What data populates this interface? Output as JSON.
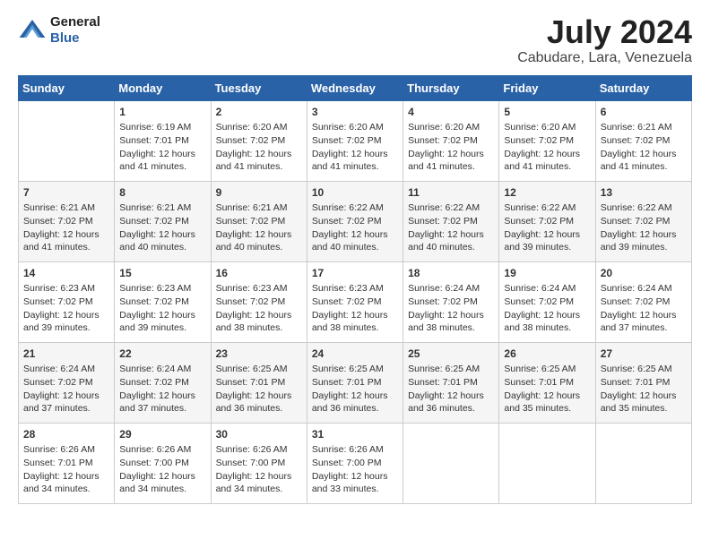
{
  "header": {
    "logo_general": "General",
    "logo_blue": "Blue",
    "month_title": "July 2024",
    "location": "Cabudare, Lara, Venezuela"
  },
  "weekdays": [
    "Sunday",
    "Monday",
    "Tuesday",
    "Wednesday",
    "Thursday",
    "Friday",
    "Saturday"
  ],
  "weeks": [
    [
      {
        "day": "",
        "info": ""
      },
      {
        "day": "1",
        "info": "Sunrise: 6:19 AM\nSunset: 7:01 PM\nDaylight: 12 hours\nand 41 minutes."
      },
      {
        "day": "2",
        "info": "Sunrise: 6:20 AM\nSunset: 7:02 PM\nDaylight: 12 hours\nand 41 minutes."
      },
      {
        "day": "3",
        "info": "Sunrise: 6:20 AM\nSunset: 7:02 PM\nDaylight: 12 hours\nand 41 minutes."
      },
      {
        "day": "4",
        "info": "Sunrise: 6:20 AM\nSunset: 7:02 PM\nDaylight: 12 hours\nand 41 minutes."
      },
      {
        "day": "5",
        "info": "Sunrise: 6:20 AM\nSunset: 7:02 PM\nDaylight: 12 hours\nand 41 minutes."
      },
      {
        "day": "6",
        "info": "Sunrise: 6:21 AM\nSunset: 7:02 PM\nDaylight: 12 hours\nand 41 minutes."
      }
    ],
    [
      {
        "day": "7",
        "info": "Sunrise: 6:21 AM\nSunset: 7:02 PM\nDaylight: 12 hours\nand 41 minutes."
      },
      {
        "day": "8",
        "info": "Sunrise: 6:21 AM\nSunset: 7:02 PM\nDaylight: 12 hours\nand 40 minutes."
      },
      {
        "day": "9",
        "info": "Sunrise: 6:21 AM\nSunset: 7:02 PM\nDaylight: 12 hours\nand 40 minutes."
      },
      {
        "day": "10",
        "info": "Sunrise: 6:22 AM\nSunset: 7:02 PM\nDaylight: 12 hours\nand 40 minutes."
      },
      {
        "day": "11",
        "info": "Sunrise: 6:22 AM\nSunset: 7:02 PM\nDaylight: 12 hours\nand 40 minutes."
      },
      {
        "day": "12",
        "info": "Sunrise: 6:22 AM\nSunset: 7:02 PM\nDaylight: 12 hours\nand 39 minutes."
      },
      {
        "day": "13",
        "info": "Sunrise: 6:22 AM\nSunset: 7:02 PM\nDaylight: 12 hours\nand 39 minutes."
      }
    ],
    [
      {
        "day": "14",
        "info": "Sunrise: 6:23 AM\nSunset: 7:02 PM\nDaylight: 12 hours\nand 39 minutes."
      },
      {
        "day": "15",
        "info": "Sunrise: 6:23 AM\nSunset: 7:02 PM\nDaylight: 12 hours\nand 39 minutes."
      },
      {
        "day": "16",
        "info": "Sunrise: 6:23 AM\nSunset: 7:02 PM\nDaylight: 12 hours\nand 38 minutes."
      },
      {
        "day": "17",
        "info": "Sunrise: 6:23 AM\nSunset: 7:02 PM\nDaylight: 12 hours\nand 38 minutes."
      },
      {
        "day": "18",
        "info": "Sunrise: 6:24 AM\nSunset: 7:02 PM\nDaylight: 12 hours\nand 38 minutes."
      },
      {
        "day": "19",
        "info": "Sunrise: 6:24 AM\nSunset: 7:02 PM\nDaylight: 12 hours\nand 38 minutes."
      },
      {
        "day": "20",
        "info": "Sunrise: 6:24 AM\nSunset: 7:02 PM\nDaylight: 12 hours\nand 37 minutes."
      }
    ],
    [
      {
        "day": "21",
        "info": "Sunrise: 6:24 AM\nSunset: 7:02 PM\nDaylight: 12 hours\nand 37 minutes."
      },
      {
        "day": "22",
        "info": "Sunrise: 6:24 AM\nSunset: 7:02 PM\nDaylight: 12 hours\nand 37 minutes."
      },
      {
        "day": "23",
        "info": "Sunrise: 6:25 AM\nSunset: 7:01 PM\nDaylight: 12 hours\nand 36 minutes."
      },
      {
        "day": "24",
        "info": "Sunrise: 6:25 AM\nSunset: 7:01 PM\nDaylight: 12 hours\nand 36 minutes."
      },
      {
        "day": "25",
        "info": "Sunrise: 6:25 AM\nSunset: 7:01 PM\nDaylight: 12 hours\nand 36 minutes."
      },
      {
        "day": "26",
        "info": "Sunrise: 6:25 AM\nSunset: 7:01 PM\nDaylight: 12 hours\nand 35 minutes."
      },
      {
        "day": "27",
        "info": "Sunrise: 6:25 AM\nSunset: 7:01 PM\nDaylight: 12 hours\nand 35 minutes."
      }
    ],
    [
      {
        "day": "28",
        "info": "Sunrise: 6:26 AM\nSunset: 7:01 PM\nDaylight: 12 hours\nand 34 minutes."
      },
      {
        "day": "29",
        "info": "Sunrise: 6:26 AM\nSunset: 7:00 PM\nDaylight: 12 hours\nand 34 minutes."
      },
      {
        "day": "30",
        "info": "Sunrise: 6:26 AM\nSunset: 7:00 PM\nDaylight: 12 hours\nand 34 minutes."
      },
      {
        "day": "31",
        "info": "Sunrise: 6:26 AM\nSunset: 7:00 PM\nDaylight: 12 hours\nand 33 minutes."
      },
      {
        "day": "",
        "info": ""
      },
      {
        "day": "",
        "info": ""
      },
      {
        "day": "",
        "info": ""
      }
    ]
  ]
}
